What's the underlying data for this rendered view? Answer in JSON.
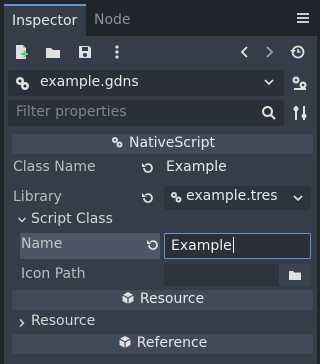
{
  "tabs": [
    {
      "label": "Inspector",
      "active": true
    },
    {
      "label": "Node",
      "active": false
    }
  ],
  "toolbar": {
    "buttons": [
      "new-resource-icon",
      "open-folder-icon",
      "save-icon",
      "more-vert-icon",
      "back-icon",
      "forward-icon",
      "history-icon"
    ]
  },
  "resource": {
    "name": "example.gdns",
    "icon": "nativescript-icon"
  },
  "filter": {
    "placeholder": "Filter properties"
  },
  "sections": {
    "nativescript": "NativeScript",
    "resource": "Resource",
    "reference": "Reference"
  },
  "properties": {
    "class_name": {
      "label": "Class Name",
      "value": "Example"
    },
    "library": {
      "label": "Library",
      "value": "example.tres"
    },
    "script_class": {
      "label": "Script Class"
    },
    "name": {
      "label": "Name",
      "value": "Example"
    },
    "icon_path": {
      "label": "Icon Path",
      "value": ""
    },
    "resource_group": {
      "label": "Resource"
    }
  },
  "colors": {
    "accent": "#6b8fd3",
    "panel": "#363d4a",
    "background": "#20242b"
  }
}
